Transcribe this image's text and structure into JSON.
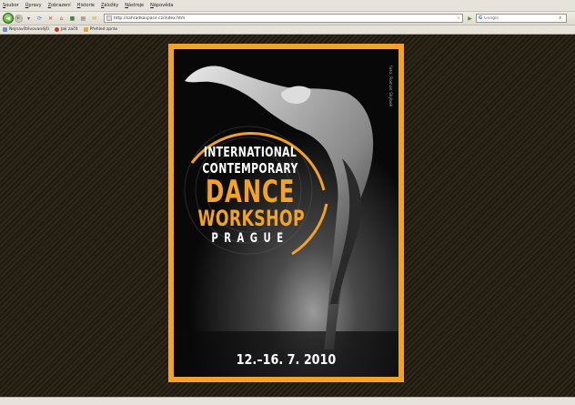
{
  "menubar": {
    "items": [
      "Soubor",
      "Úpravy",
      "Zobrazení",
      "Historie",
      "Záložky",
      "Nástroje",
      "Nápověda"
    ]
  },
  "navbar": {
    "url": "http://sahradkaspace.cz/index.htm",
    "search_placeholder": "Google"
  },
  "bookmarks": {
    "items": [
      {
        "label": "Nejnavštěvovanější",
        "color": "#6f8fbf"
      },
      {
        "label": "Jak začít",
        "color": "#c73b2b"
      },
      {
        "label": "Přehled zpráv",
        "color": "#e8a33a"
      }
    ]
  },
  "poster": {
    "photo_credit": "foto: Roman Skýbek",
    "line1": "INTERNATIONAL",
    "line2": "CONTEMPORARY",
    "line3": "DANCE",
    "line4": "WORKSHOP",
    "line5": "PRAGUE",
    "dates": "12.–16. 7. 2010",
    "accent_color": "#f2a227"
  }
}
